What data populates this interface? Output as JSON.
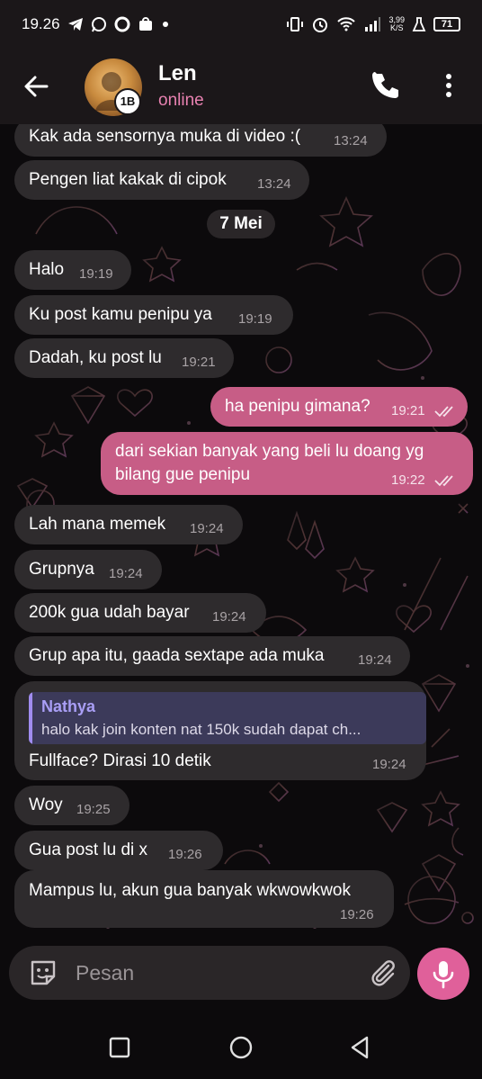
{
  "status_bar": {
    "time": "19.26",
    "net_speed_value": "3,99",
    "net_speed_unit": "K/S",
    "battery": "71"
  },
  "header": {
    "contact_name": "Len",
    "contact_status": "online",
    "avatar_badge": "1B"
  },
  "date_separator": "7 Mei",
  "messages": [
    {
      "dir": "in",
      "text": "Kak ada sensornya muka di video :(",
      "time": "13:24"
    },
    {
      "dir": "in",
      "text": "Pengen liat kakak di cipok",
      "time": "13:24"
    },
    {
      "dir": "in",
      "text": "Halo",
      "time": "19:19"
    },
    {
      "dir": "in",
      "text": "Ku post kamu penipu ya",
      "time": "19:19"
    },
    {
      "dir": "in",
      "text": "Dadah, ku post lu",
      "time": "19:21"
    },
    {
      "dir": "out",
      "text": "ha penipu gimana?",
      "time": "19:21"
    },
    {
      "dir": "out",
      "text_line1": "dari sekian banyak yang beli lu doang yg",
      "text_line2": "bilang gue penipu",
      "time": "19:22"
    },
    {
      "dir": "in",
      "text": "Lah mana memek",
      "time": "19:24"
    },
    {
      "dir": "in",
      "text": "Grupnya",
      "time": "19:24"
    },
    {
      "dir": "in",
      "text": "200k gua udah bayar",
      "time": "19:24"
    },
    {
      "dir": "in",
      "text": "Grup apa itu, gaada sextape ada muka",
      "time": "19:24"
    },
    {
      "dir": "in",
      "reply_name": "Nathya",
      "reply_text": "halo kak join konten nat 150k sudah dapat ch...",
      "text": "Fullface? Dirasi 10 detik",
      "time": "19:24"
    },
    {
      "dir": "in",
      "text": "Woy",
      "time": "19:25"
    },
    {
      "dir": "in",
      "text": "Gua post lu di x",
      "time": "19:26"
    },
    {
      "dir": "in",
      "text": "Mampus lu, akun gua banyak wkwowkwok",
      "time": "19:26"
    }
  ],
  "input": {
    "placeholder": "Pesan"
  },
  "colors": {
    "incoming_bubble": "#2e2b2d",
    "outgoing_bubble": "#c75d86",
    "accent": "#e0609a",
    "status_online": "#e781b0",
    "reply_accent": "#a08cf0"
  },
  "icons": [
    "back-arrow-icon",
    "phone-icon",
    "more-vertical-icon",
    "emoji-sticker-icon",
    "paperclip-icon",
    "microphone-icon",
    "double-check-icon"
  ]
}
